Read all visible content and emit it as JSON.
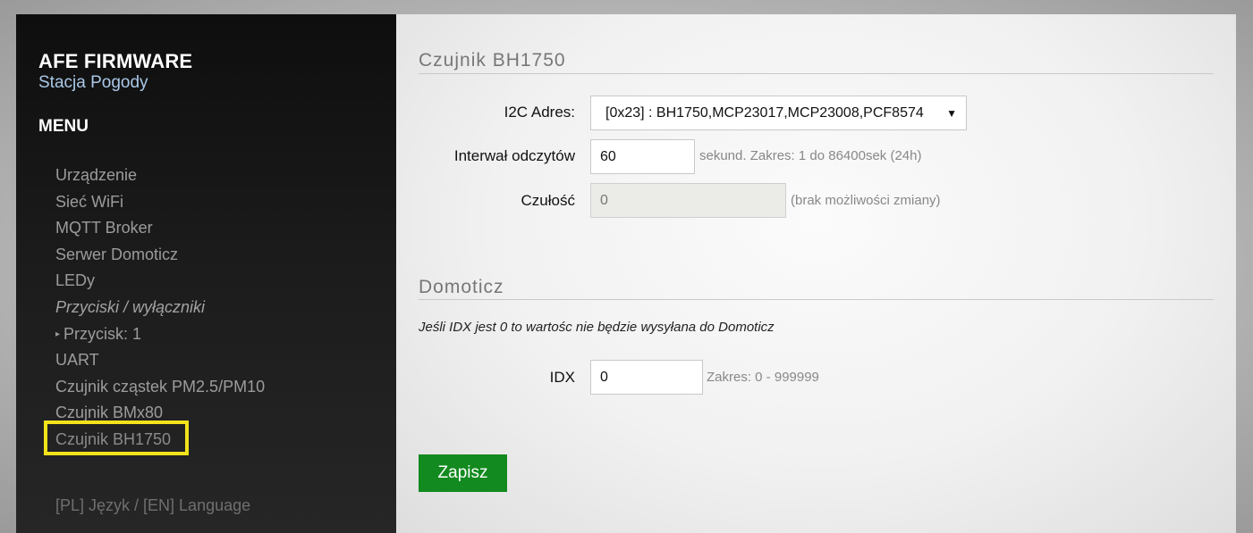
{
  "sidebar": {
    "brand_title": "AFE FIRMWARE",
    "brand_subtitle": "Stacja Pogody",
    "menu_title": "MENU",
    "items": [
      {
        "label": "Urządzenie",
        "type": "link"
      },
      {
        "label": "Sieć WiFi",
        "type": "link"
      },
      {
        "label": "MQTT Broker",
        "type": "link"
      },
      {
        "label": "Serwer Domoticz",
        "type": "link"
      },
      {
        "label": "LEDy",
        "type": "link"
      },
      {
        "label": "Przyciski / wyłączniki",
        "type": "section"
      },
      {
        "label": "Przycisk: 1",
        "type": "sublink"
      },
      {
        "label": "UART",
        "type": "link"
      },
      {
        "label": "Czujnik cząstek PM2.5/PM10",
        "type": "link"
      },
      {
        "label": "Czujnik BMx80",
        "type": "link"
      },
      {
        "label": "Czujnik BH1750",
        "type": "link",
        "selected": true
      }
    ],
    "language_link": "[PL] Język / [EN] Language",
    "highlight_color": "#f2e21a"
  },
  "main": {
    "sensor_section": {
      "title": "Czujnik BH1750",
      "i2c_label": "I2C Adres:",
      "i2c_value": "[0x23] : BH1750,MCP23017,MCP23008,PCF8574",
      "interval_label": "Interwał odczytów",
      "interval_value": "60",
      "interval_hint": "sekund. Zakres: 1 do 86400sek (24h)",
      "sensitivity_label": "Czułość",
      "sensitivity_value": "0",
      "sensitivity_hint": "(brak możliwości zmiany)"
    },
    "domoticz_section": {
      "title": "Domoticz",
      "note": "Jeśli IDX jest 0 to wartośc nie będzie wysyłana do Domoticz",
      "idx_label": "IDX",
      "idx_value": "0",
      "idx_hint": "Zakres: 0 - 999999"
    },
    "save_label": "Zapisz",
    "save_color": "#138a1f"
  }
}
